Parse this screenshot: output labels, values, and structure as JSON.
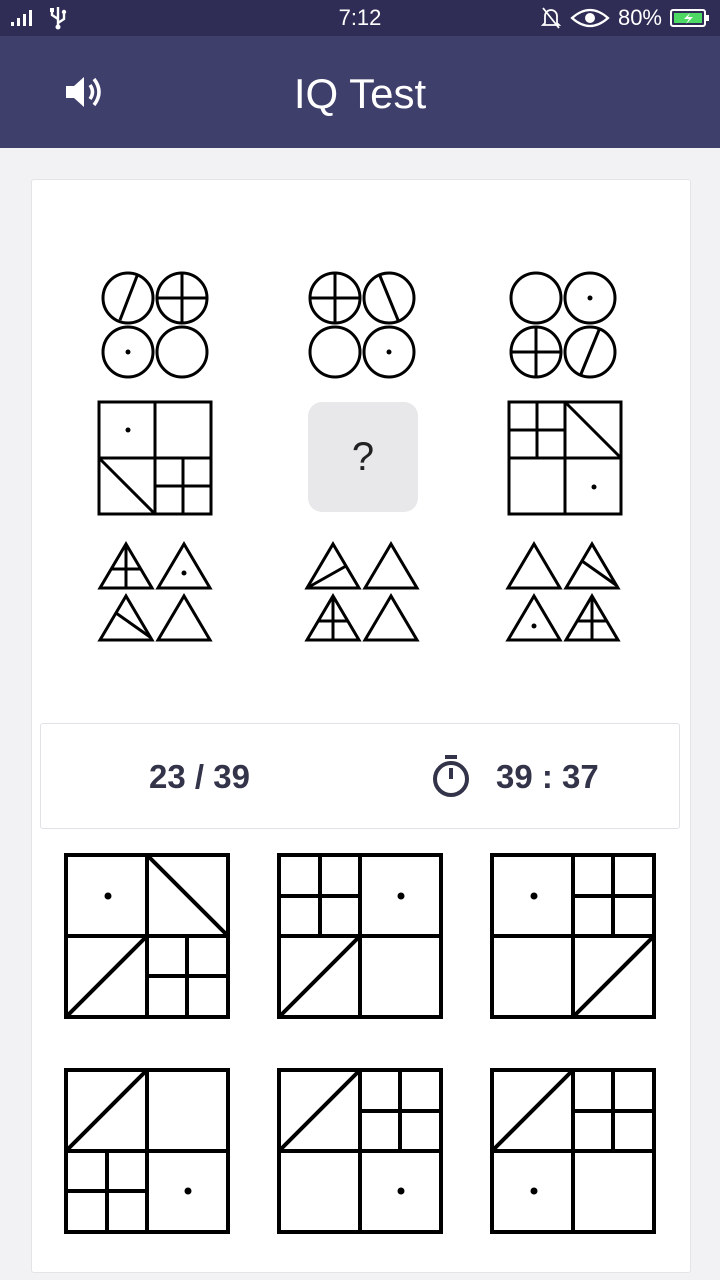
{
  "status_bar": {
    "time": "7:12",
    "battery": "80%",
    "icons": [
      "signal-icon",
      "usb-icon",
      "bell-off-icon",
      "eye-icon",
      "battery-charging-icon"
    ]
  },
  "app_bar": {
    "title": "IQ Test",
    "sound_icon": "speaker-icon"
  },
  "puzzle": {
    "missing_label": "?"
  },
  "score": {
    "progress": "23 / 39",
    "timer": "39 : 37",
    "timer_icon": "stopwatch-icon"
  },
  "colors": {
    "status_bar": "#2f2d55",
    "app_bar": "#3f3f6c",
    "text_dark": "#33334a",
    "missing_cell": "#e8e8ea"
  }
}
